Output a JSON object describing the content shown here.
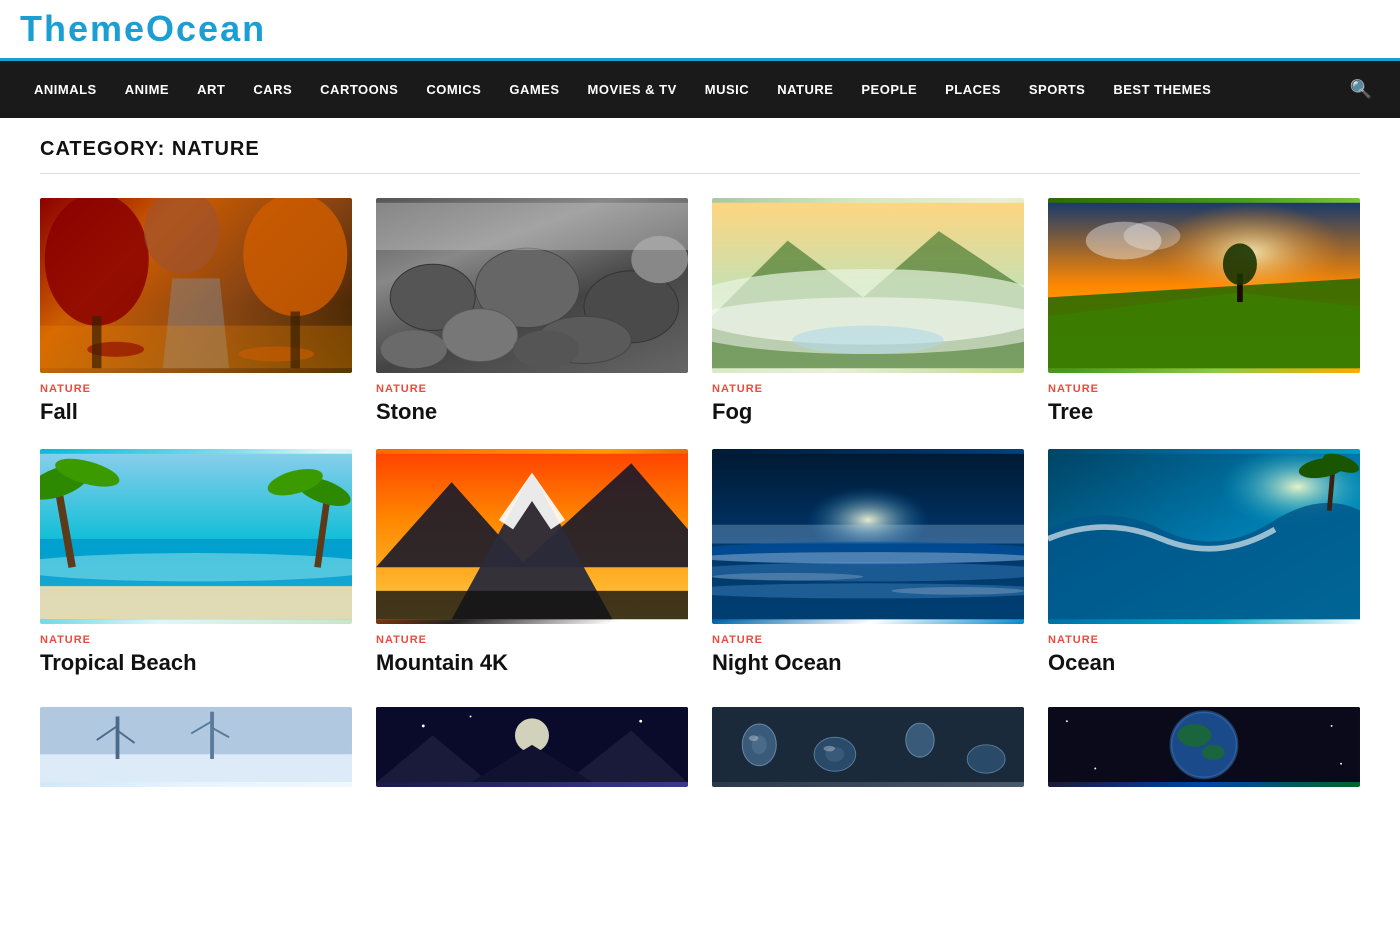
{
  "logo": {
    "text": "ThemeOcean"
  },
  "nav": {
    "items": [
      {
        "label": "ANIMALS",
        "id": "animals"
      },
      {
        "label": "ANIME",
        "id": "anime"
      },
      {
        "label": "ART",
        "id": "art"
      },
      {
        "label": "CARS",
        "id": "cars"
      },
      {
        "label": "CARTOONS",
        "id": "cartoons"
      },
      {
        "label": "COMICS",
        "id": "comics"
      },
      {
        "label": "GAMES",
        "id": "games"
      },
      {
        "label": "MOVIES & TV",
        "id": "movies-tv"
      },
      {
        "label": "MUSIC",
        "id": "music"
      },
      {
        "label": "NATURE",
        "id": "nature"
      },
      {
        "label": "PEOPLE",
        "id": "people"
      },
      {
        "label": "PLACES",
        "id": "places"
      },
      {
        "label": "SPORTS",
        "id": "sports"
      },
      {
        "label": "BEST THEMES",
        "id": "best-themes"
      }
    ]
  },
  "category_header": "CATEGORY: NATURE",
  "cards": [
    {
      "category": "NATURE",
      "title": "Fall",
      "image_class": "img-fall"
    },
    {
      "category": "NATURE",
      "title": "Stone",
      "image_class": "img-stone"
    },
    {
      "category": "NATURE",
      "title": "Fog",
      "image_class": "img-fog"
    },
    {
      "category": "NATURE",
      "title": "Tree",
      "image_class": "img-tree"
    },
    {
      "category": "NATURE",
      "title": "Tropical Beach",
      "image_class": "img-tropical"
    },
    {
      "category": "NATURE",
      "title": "Mountain 4K",
      "image_class": "img-mountain"
    },
    {
      "category": "NATURE",
      "title": "Night Ocean",
      "image_class": "img-night-ocean"
    },
    {
      "category": "NATURE",
      "title": "Ocean",
      "image_class": "img-ocean"
    }
  ],
  "partial_cards": [
    {
      "image_class": "img-snow-tree"
    },
    {
      "image_class": "img-moon"
    },
    {
      "image_class": "img-drops"
    },
    {
      "image_class": "img-earth"
    }
  ],
  "colors": {
    "nav_bg": "#1a1a1a",
    "accent": "#e74c3c",
    "title_color": "#111"
  }
}
